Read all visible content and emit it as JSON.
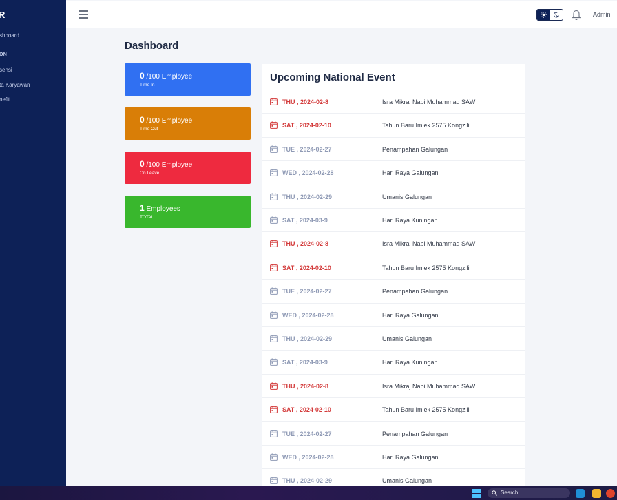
{
  "sidebar": {
    "logo": "R",
    "items": [
      {
        "label": "shboard"
      },
      {
        "label": "ON"
      },
      {
        "label": "sensi"
      },
      {
        "label": "ta Karyawan"
      },
      {
        "label": "nefit"
      }
    ]
  },
  "topbar": {
    "admin_label": "Admin"
  },
  "page": {
    "title": "Dashboard"
  },
  "stats": [
    {
      "value": "0",
      "unit": "/100 Employee",
      "caption": "Time In",
      "color": "#3070f2"
    },
    {
      "value": "0",
      "unit": "/100 Employee",
      "caption": "Time Out",
      "color": "#d97e07"
    },
    {
      "value": "0",
      "unit": "/100 Employee",
      "caption": "On Leave",
      "color": "#ee2a3f"
    },
    {
      "value": "1",
      "unit": "Employees",
      "caption": "TOTAL",
      "color": "#39b72d"
    }
  ],
  "events": {
    "title": "Upcoming National Event",
    "colors": {
      "weekend": "#d33a3a",
      "weekday": "#8f9ab5"
    },
    "rows": [
      {
        "date": "THU , 2024-02-8",
        "name": "Isra Mikraj Nabi Muhammad SAW",
        "weekend": true
      },
      {
        "date": "SAT , 2024-02-10",
        "name": "Tahun Baru Imlek 2575 Kongzili",
        "weekend": true
      },
      {
        "date": "TUE , 2024-02-27",
        "name": "Penampahan Galungan",
        "weekend": false
      },
      {
        "date": "WED , 2024-02-28",
        "name": "Hari Raya Galungan",
        "weekend": false
      },
      {
        "date": "THU , 2024-02-29",
        "name": "Umanis Galungan",
        "weekend": false
      },
      {
        "date": "SAT , 2024-03-9",
        "name": "Hari Raya Kuningan",
        "weekend": false
      },
      {
        "date": "THU , 2024-02-8",
        "name": "Isra Mikraj Nabi Muhammad SAW",
        "weekend": true
      },
      {
        "date": "SAT , 2024-02-10",
        "name": "Tahun Baru Imlek 2575 Kongzili",
        "weekend": true
      },
      {
        "date": "TUE , 2024-02-27",
        "name": "Penampahan Galungan",
        "weekend": false
      },
      {
        "date": "WED , 2024-02-28",
        "name": "Hari Raya Galungan",
        "weekend": false
      },
      {
        "date": "THU , 2024-02-29",
        "name": "Umanis Galungan",
        "weekend": false
      },
      {
        "date": "SAT , 2024-03-9",
        "name": "Hari Raya Kuningan",
        "weekend": false
      },
      {
        "date": "THU , 2024-02-8",
        "name": "Isra Mikraj Nabi Muhammad SAW",
        "weekend": true
      },
      {
        "date": "SAT , 2024-02-10",
        "name": "Tahun Baru Imlek 2575 Kongzili",
        "weekend": true
      },
      {
        "date": "TUE , 2024-02-27",
        "name": "Penampahan Galungan",
        "weekend": false
      },
      {
        "date": "WED , 2024-02-28",
        "name": "Hari Raya Galungan",
        "weekend": false
      },
      {
        "date": "THU , 2024-02-29",
        "name": "Umanis Galungan",
        "weekend": false
      }
    ]
  },
  "taskbar": {
    "search_label": "Search"
  }
}
